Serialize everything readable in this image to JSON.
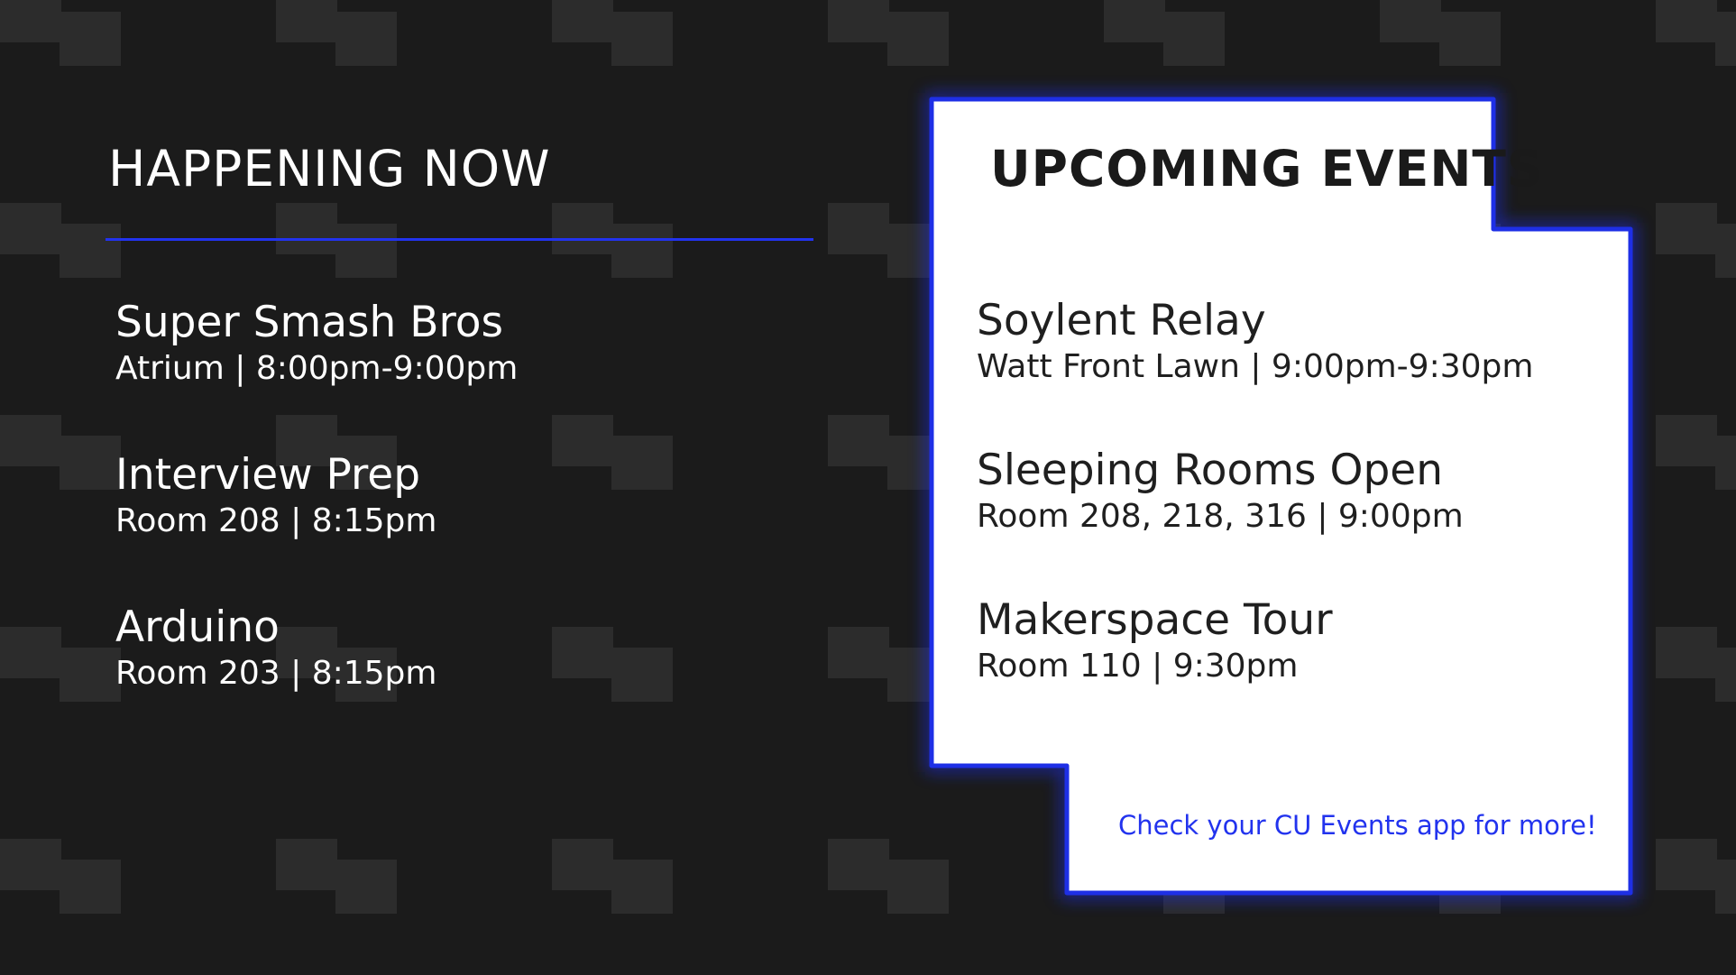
{
  "happening_now": {
    "heading": "HAPPENING NOW",
    "events": [
      {
        "title": "Super Smash Bros",
        "details": "Atrium | 8:00pm-9:00pm"
      },
      {
        "title": "Interview Prep",
        "details": "Room 208 | 8:15pm"
      },
      {
        "title": "Arduino",
        "details": "Room 203 | 8:15pm"
      }
    ]
  },
  "upcoming": {
    "heading": "UPCOMING EVENTS",
    "events": [
      {
        "title": "Soylent Relay",
        "details": "Watt Front Lawn | 9:00pm-9:30pm"
      },
      {
        "title": "Sleeping Rooms Open",
        "details": "Room 208, 218, 316 | 9:00pm"
      },
      {
        "title": "Makerspace Tour",
        "details": "Room 110 | 9:30pm"
      }
    ],
    "footer_link": "Check your CU Events app for more!"
  },
  "colors": {
    "background": "#1b1b1b",
    "pattern": "#2c2c2c",
    "accent_blue": "#2233ee",
    "panel": "#ffffff"
  }
}
